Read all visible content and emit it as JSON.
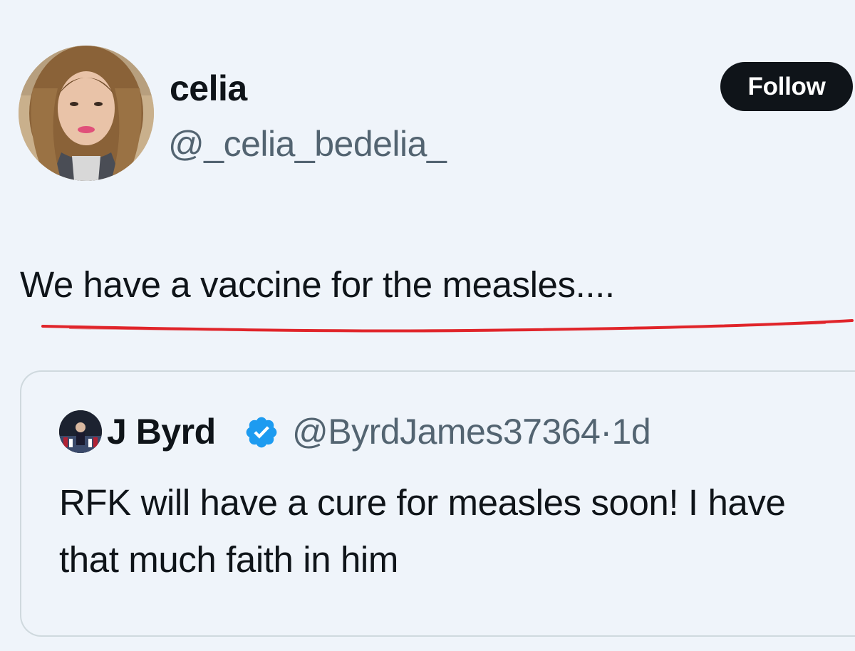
{
  "author": {
    "display_name": "celia",
    "handle": "@_celia_bedelia_",
    "avatar_icon": "profile-photo"
  },
  "follow_button": {
    "label": "Follow"
  },
  "tweet": {
    "text": "We have a vaccine for the measles....",
    "annotation_color": "#e0242a"
  },
  "quoted_tweet": {
    "display_name": "J Byrd",
    "verified_icon": "verified-badge-icon",
    "handle_and_time": "@ByrdJames37364·1d",
    "text": "RFK will have a cure for measles soon! I have that much faith in him"
  },
  "colors": {
    "background": "#eff4fa",
    "primary_text": "#0f1419",
    "secondary_text": "#536471",
    "verified_blue": "#1d9bf0",
    "border": "#cfd9de"
  }
}
